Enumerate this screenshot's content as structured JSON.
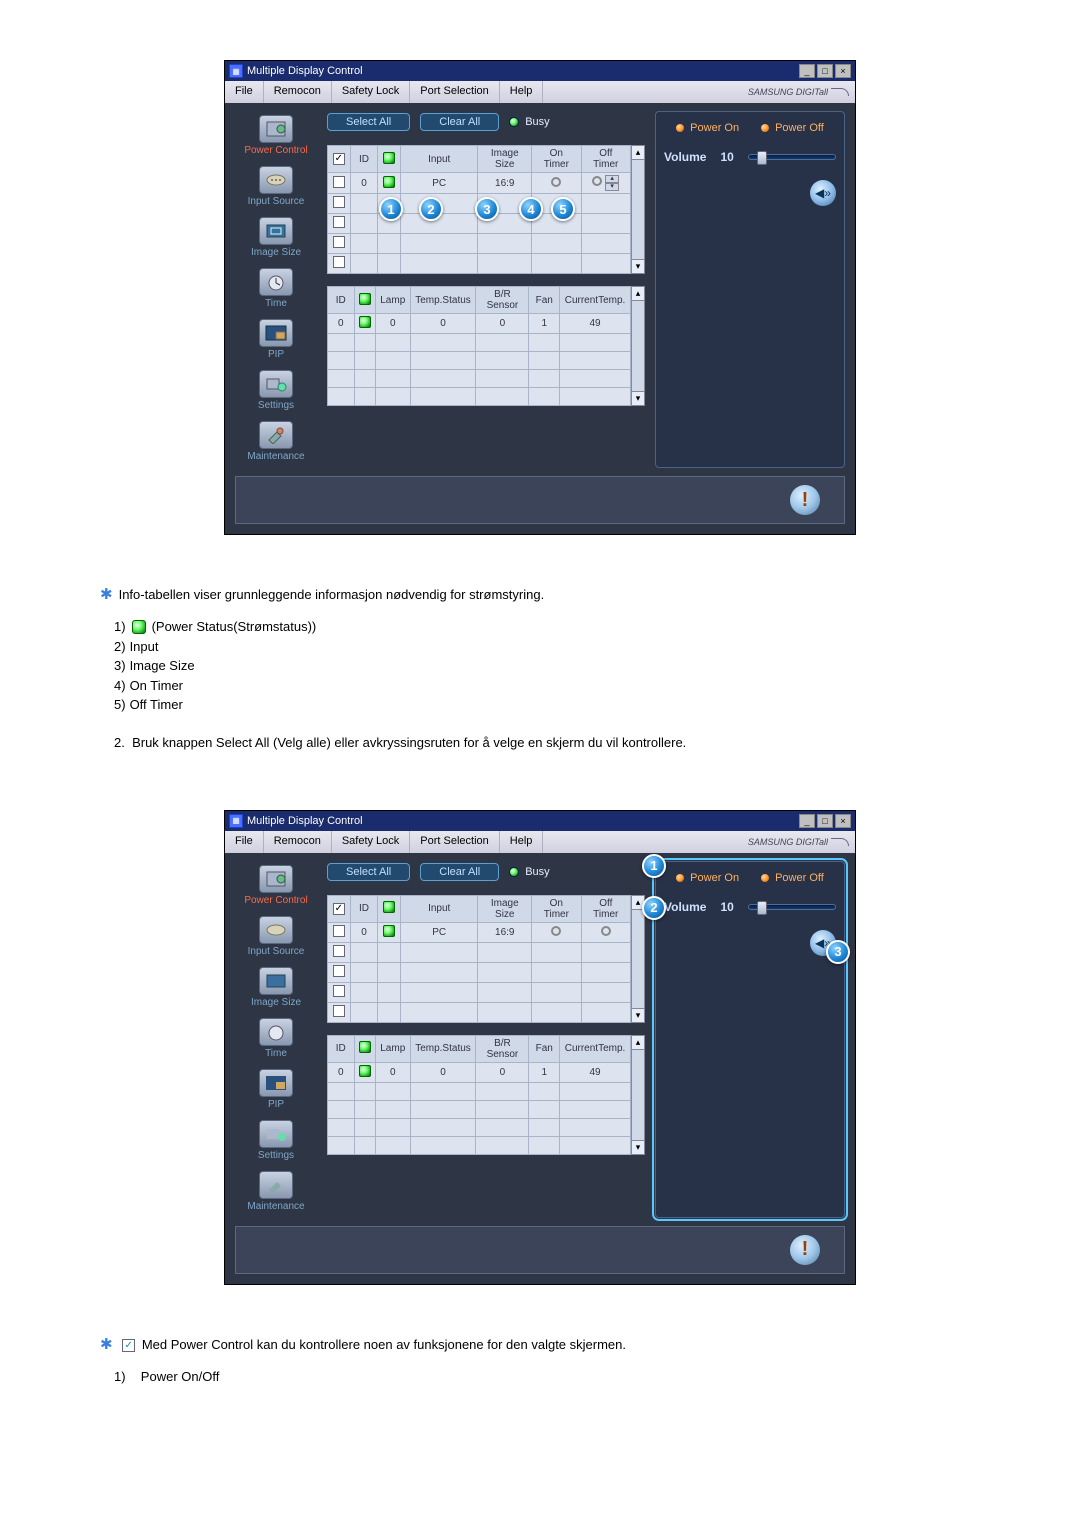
{
  "app": {
    "title": "Multiple Display Control",
    "menu": [
      "File",
      "Remocon",
      "Safety Lock",
      "Port Selection",
      "Help"
    ],
    "brand": "SAMSUNG DIGITall"
  },
  "sidebar": {
    "items": [
      {
        "label": "Power Control",
        "active": true
      },
      {
        "label": "Input Source"
      },
      {
        "label": "Image Size"
      },
      {
        "label": "Time"
      },
      {
        "label": "PIP"
      },
      {
        "label": "Settings"
      },
      {
        "label": "Maintenance"
      }
    ]
  },
  "toolbar": {
    "select_all": "Select All",
    "clear_all": "Clear All",
    "busy": "Busy"
  },
  "grid1": {
    "headers": [
      "",
      "ID",
      "",
      "Input",
      "Image Size",
      "On Timer",
      "Off Timer"
    ],
    "row": {
      "id": "0",
      "input": "PC",
      "image_size": "16:9"
    }
  },
  "grid2": {
    "headers": [
      "ID",
      "",
      "Lamp",
      "Temp.Status",
      "B/R Sensor",
      "Fan",
      "CurrentTemp."
    ],
    "row": {
      "id": "0",
      "lamp": "0",
      "temp_status": "0",
      "br": "0",
      "fan": "1",
      "cur": "49"
    }
  },
  "rpanel": {
    "power_on": "Power On",
    "power_off": "Power Off",
    "volume_label": "Volume",
    "volume_value": "10"
  },
  "callouts1": [
    "1",
    "2",
    "3",
    "4",
    "5"
  ],
  "callouts2": [
    "1",
    "2",
    "3"
  ],
  "text": {
    "s1_intro": "Info-tabellen viser grunnleggende informasjon nødvendig for strømstyring.",
    "s1_list": [
      "(Power Status(Strømstatus))",
      "Input",
      "Image Size",
      "On Timer",
      "Off Timer"
    ],
    "s1_item2": "Bruk knappen Select All (Velg alle) eller avkryssingsruten for å velge en skjerm du vil kontrollere.",
    "s2_intro": "Med Power Control kan du kontrollere noen av funksjonene for den valgte skjermen.",
    "s2_list1": "Power On/Off"
  }
}
